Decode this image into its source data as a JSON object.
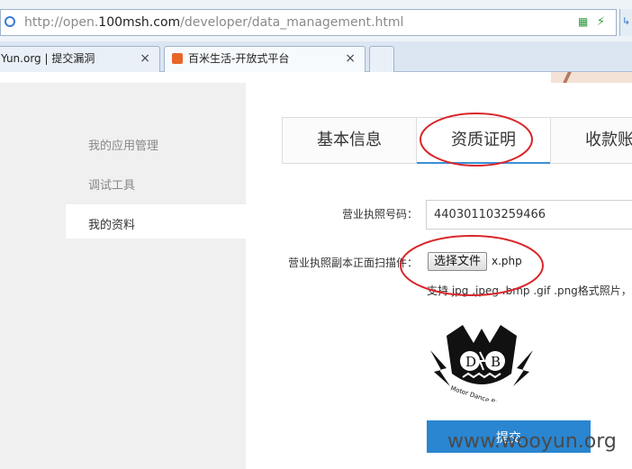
{
  "browser": {
    "url_prefix": "http://open.",
    "url_domain": "100msh.com",
    "url_path": "/developer/data_management.html",
    "tabs": [
      {
        "label": "Yun.org | 提交漏洞",
        "close": "×"
      },
      {
        "label": "百米生活-开放式平台",
        "close": "×"
      }
    ],
    "edge_icon": "↳"
  },
  "sidebar": {
    "items": [
      {
        "label": "我的应用管理"
      },
      {
        "label": "调试工具"
      },
      {
        "label": "我的资料"
      }
    ]
  },
  "content_tabs": [
    {
      "label": "基本信息"
    },
    {
      "label": "资质证明"
    },
    {
      "label": "收款账"
    }
  ],
  "form": {
    "license_label": "营业执照号码：",
    "license_value": "440301103259466",
    "scan_label": "营业执照副本正面扫描件：",
    "file_button": "选择文件",
    "file_name": "x.php",
    "hint": "支持.jpg .jpeg .bmp .gif .png格式照片，大小",
    "submit": "提交"
  },
  "logo": {
    "letters_left": "D",
    "letters_right": "B",
    "motto": "Motor Dance Band"
  },
  "watermark": "www.wooyun.org",
  "colors": {
    "accent": "#2a86d0",
    "annotation": "#d9262b"
  }
}
